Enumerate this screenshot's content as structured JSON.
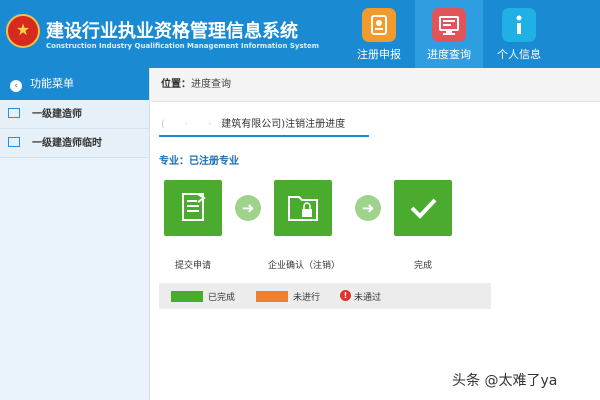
{
  "header": {
    "title": "建设行业执业资格管理信息系统",
    "subtitle": "Construction Industry Qualification Management Information System",
    "nav": [
      {
        "label": "注册申报",
        "icon": "register-icon"
      },
      {
        "label": "进度查询",
        "icon": "progress-query-icon",
        "active": true
      },
      {
        "label": "个人信息",
        "icon": "info-icon"
      }
    ]
  },
  "sidebar": {
    "header": "功能菜单",
    "items": [
      {
        "label": "一级建造师",
        "icon": "document-icon"
      },
      {
        "label": "一级建造师临时",
        "icon": "chat-icon"
      }
    ]
  },
  "main": {
    "breadcrumb_label": "位置：",
    "breadcrumb_value": "进度查询",
    "tab_label": "建筑有限公司)注销注册进度",
    "section_title": "专业：已注册专业",
    "steps": [
      {
        "label": "提交申请",
        "icon": "document-refresh-icon"
      },
      {
        "label": "企业确认（注销）",
        "icon": "folder-lock-icon"
      },
      {
        "label": "完成",
        "icon": "checkmark-icon"
      }
    ],
    "legend": {
      "done": "已完成",
      "in_progress": "未进行",
      "failed": "未通过"
    },
    "colors": {
      "done": "#4bab2e",
      "in_progress": "#f07e2a",
      "failed": "#e0312f",
      "accent": "#1a8ad2"
    }
  },
  "watermark": "头条 @太难了ya"
}
